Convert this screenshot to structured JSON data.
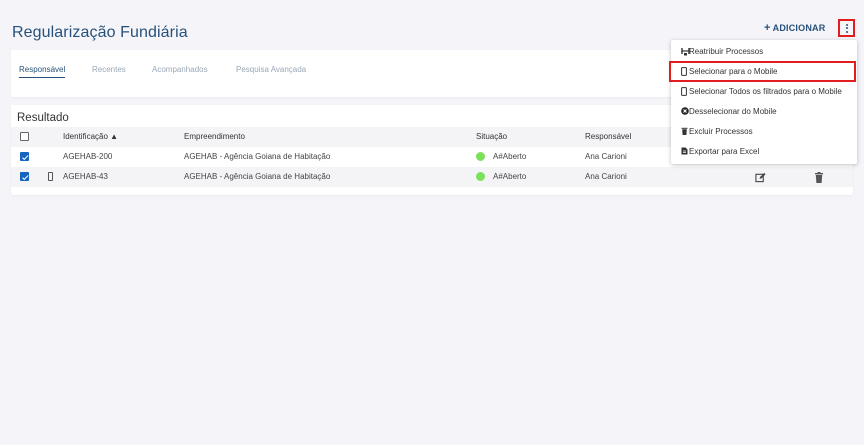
{
  "header": {
    "title": "Regularização Fundiária",
    "add_label": "ADICIONAR",
    "add_plus": "+"
  },
  "tabs": [
    {
      "label": "Responsável",
      "active": true
    },
    {
      "label": "Recentes",
      "active": false
    },
    {
      "label": "Acompanhados",
      "active": false
    },
    {
      "label": "Pesquisa Avançada",
      "active": false
    }
  ],
  "result": {
    "title": "Resultado",
    "columns": [
      "Identificação ▲",
      "Empreendimento",
      "Situação",
      "Responsável"
    ],
    "rows": [
      {
        "checked": true,
        "mobile": false,
        "identificacao": "AGEHAB-200",
        "empreendimento": "AGEHAB - Agência Goiana de Habitação",
        "situacao": "A#Aberto",
        "responsavel": "Ana Carioni",
        "status_color": "#7be05a"
      },
      {
        "checked": true,
        "mobile": true,
        "identificacao": "AGEHAB-43",
        "empreendimento": "AGEHAB - Agência Goiana de Habitação",
        "situacao": "A#Aberto",
        "responsavel": "Ana Carioni",
        "status_color": "#7be05a"
      }
    ]
  },
  "menu": {
    "items": [
      {
        "label": "Reatribuir Processos",
        "icon": "reassign-icon"
      },
      {
        "label": "Selecionar para o Mobile",
        "icon": "mobile-icon",
        "highlighted": true
      },
      {
        "label": "Selecionar Todos os filtrados para o Mobile",
        "icon": "mobile-icon"
      },
      {
        "label": "Desselecionar do Mobile",
        "icon": "remove-circle-icon"
      },
      {
        "label": "Excluir Processos",
        "icon": "trash-icon"
      },
      {
        "label": "Exportar para Excel",
        "icon": "excel-icon"
      }
    ]
  },
  "colors": {
    "brand": "#27517a",
    "highlight_border": "#e01e1e",
    "checkbox": "#1565c0",
    "status_open": "#7be05a"
  }
}
